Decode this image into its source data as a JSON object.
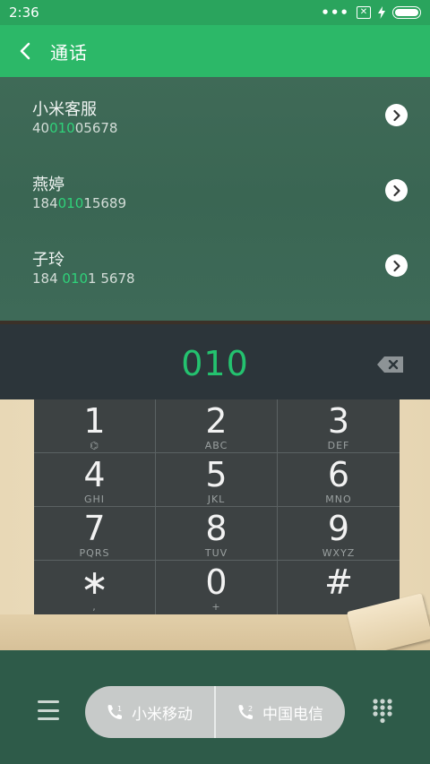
{
  "status": {
    "time": "2:36",
    "dots": "•••",
    "sim_x": "✕"
  },
  "header": {
    "title": "通话"
  },
  "contacts": [
    {
      "name": "小米客服",
      "num_pre": "40",
      "num_hl": "010",
      "num_post": "05678"
    },
    {
      "name": "燕婷",
      "num_pre": "184",
      "num_hl": "010",
      "num_post": "15689"
    },
    {
      "name": "子玲",
      "num_pre": "184 ",
      "num_hl": "010",
      "num_post": "1 5678"
    }
  ],
  "display": {
    "digits": "010"
  },
  "keypad": [
    {
      "digit": "1",
      "letters": "⌬"
    },
    {
      "digit": "2",
      "letters": "ABC"
    },
    {
      "digit": "3",
      "letters": "DEF"
    },
    {
      "digit": "4",
      "letters": "GHI"
    },
    {
      "digit": "5",
      "letters": "JKL"
    },
    {
      "digit": "6",
      "letters": "MNO"
    },
    {
      "digit": "7",
      "letters": "PQRS"
    },
    {
      "digit": "8",
      "letters": "TUV"
    },
    {
      "digit": "9",
      "letters": "WXYZ"
    },
    {
      "digit": "∗",
      "letters": ","
    },
    {
      "digit": "0",
      "letters": "+"
    },
    {
      "digit": "#",
      "letters": ""
    }
  ],
  "bottom": {
    "sim1_label": "小米移动",
    "sim2_label": "中国电信"
  },
  "colors": {
    "status_bar": "#2aa45d",
    "header": "#2cb868",
    "highlight": "#2fd27a"
  }
}
